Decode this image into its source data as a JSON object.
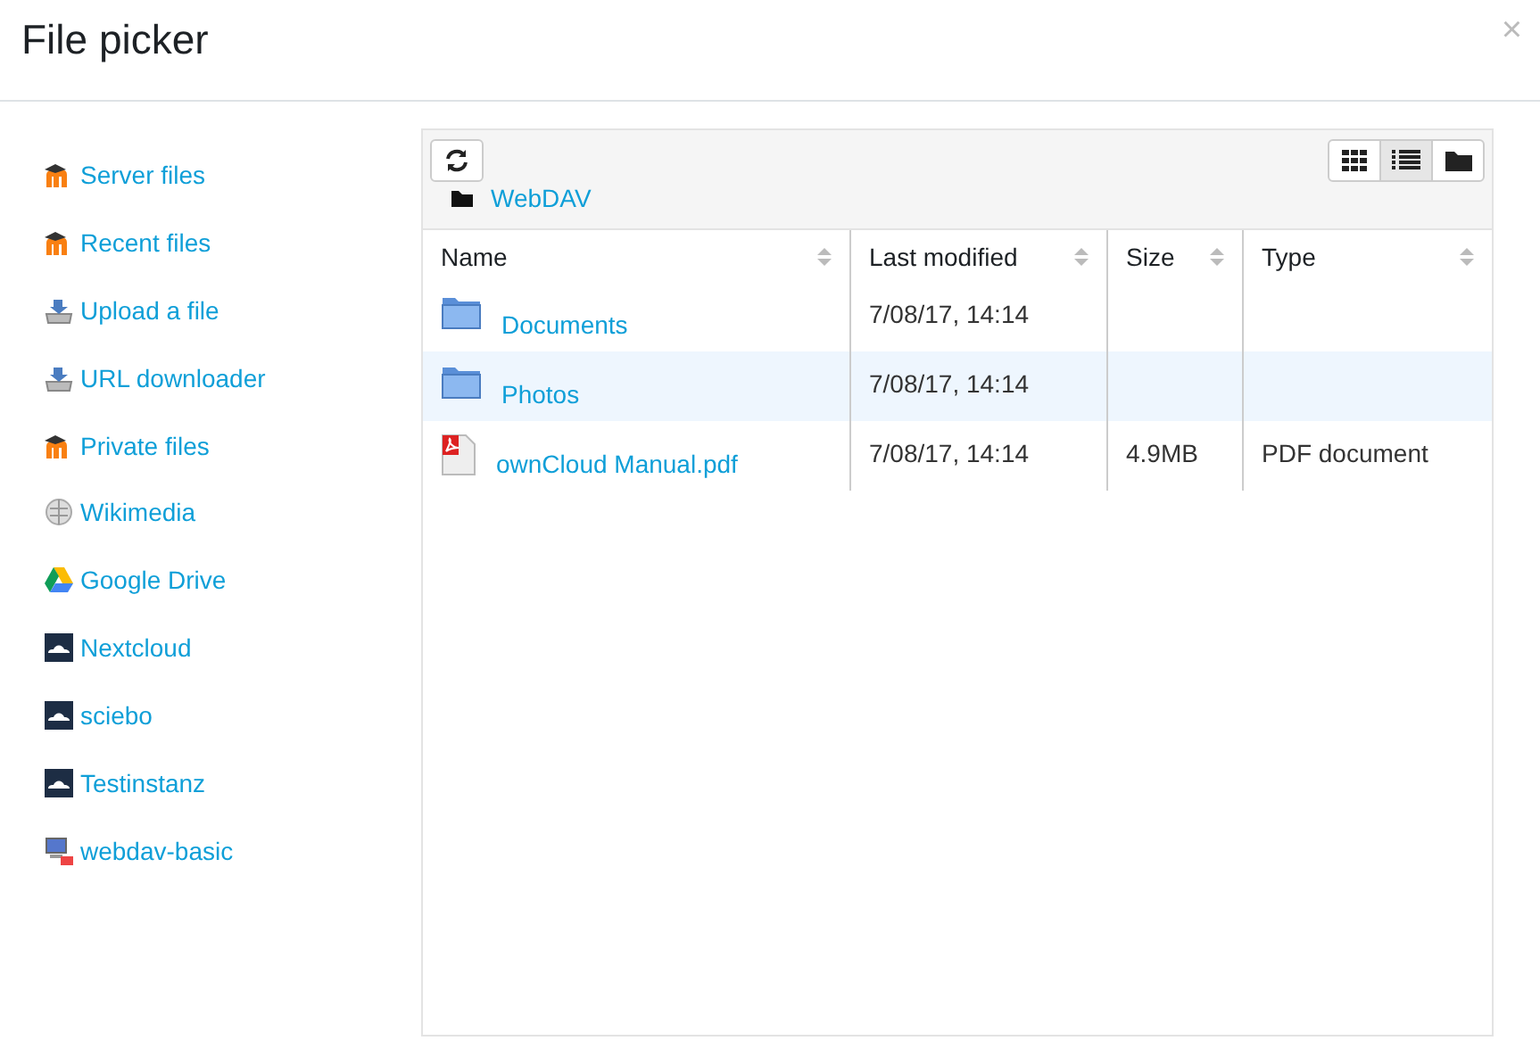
{
  "dialog": {
    "title": "File picker",
    "close": "×"
  },
  "repositories": [
    {
      "label": "Server files",
      "kind": "moodle"
    },
    {
      "label": "Recent files",
      "kind": "moodle"
    },
    {
      "label": "Upload a file",
      "kind": "upload"
    },
    {
      "label": "URL downloader",
      "kind": "upload"
    },
    {
      "label": "Private files",
      "kind": "moodle"
    },
    {
      "label": "Wikimedia",
      "kind": "wiki"
    },
    {
      "label": "Google Drive",
      "kind": "gdrive"
    },
    {
      "label": "Nextcloud",
      "kind": "cloud"
    },
    {
      "label": "sciebo",
      "kind": "cloud"
    },
    {
      "label": "Testinstanz",
      "kind": "cloud"
    },
    {
      "label": "webdav-basic",
      "kind": "webdav"
    }
  ],
  "view_buttons": [
    {
      "kind": "icons",
      "selected": false
    },
    {
      "kind": "list",
      "selected": true
    },
    {
      "kind": "tree",
      "selected": false
    }
  ],
  "breadcrumb": [
    "WebDAV"
  ],
  "table": {
    "columns": [
      "Name",
      "Last modified",
      "Size",
      "Type"
    ],
    "rows": [
      {
        "kind": "folder",
        "name": "Documents",
        "modified": "7/08/17, 14:14",
        "selected": false
      },
      {
        "kind": "folder",
        "name": "Photos",
        "modified": "7/08/17, 14:14",
        "selected": true
      },
      {
        "kind": "pdf",
        "name": "ownCloud Manual.pdf",
        "modified": "7/08/17, 14:14",
        "size": "4.9MB",
        "type": "PDF document",
        "selected": false
      }
    ]
  }
}
